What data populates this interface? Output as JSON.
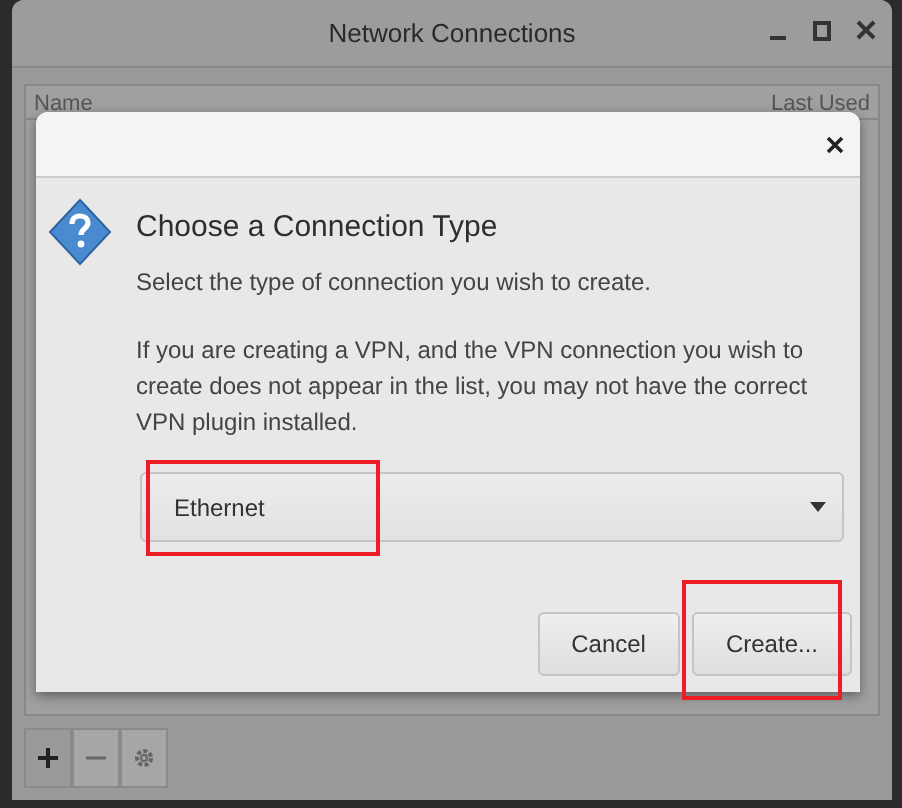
{
  "window": {
    "title": "Network Connections"
  },
  "columns": [
    "Name",
    "Last Used"
  ],
  "dialog": {
    "heading": "Choose a Connection Type",
    "text": "Select the type of connection you wish to create.",
    "note": "If you are creating a VPN, and the VPN connection you wish to create does not appear in the list, you may not have the correct VPN plugin installed.",
    "select": {
      "value": "Ethernet",
      "highlighted": true
    },
    "buttons": [
      {
        "label": "Cancel",
        "highlighted": false
      },
      {
        "label": "Create...",
        "highlighted": true
      }
    ]
  }
}
